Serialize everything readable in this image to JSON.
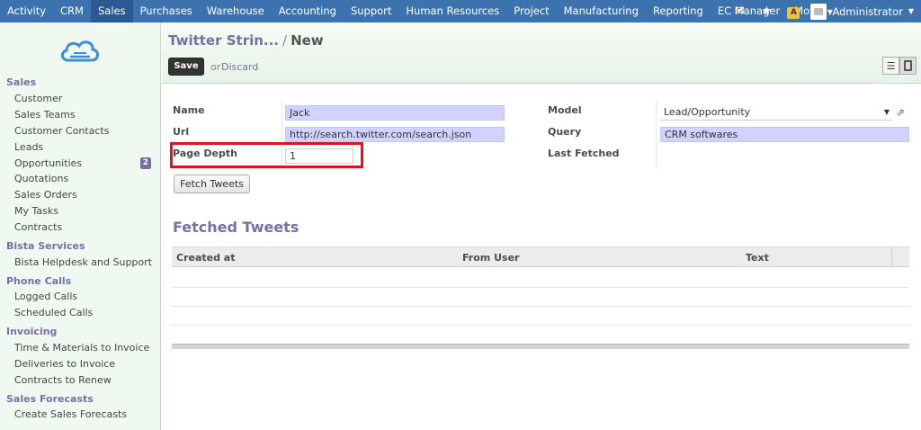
{
  "topnav": {
    "items": [
      "Activity",
      "CRM",
      "Sales",
      "Purchases",
      "Warehouse",
      "Accounting",
      "Support",
      "Human Resources",
      "Project",
      "Manufacturing",
      "Reporting",
      "EC Manager",
      "More"
    ],
    "active": "Sales",
    "user": "Administrator",
    "warning_badge": "A"
  },
  "sidebar": {
    "sections": [
      {
        "title": "Sales",
        "items": [
          "Customer",
          "Sales Teams",
          "Customer Contacts",
          "Leads",
          "Opportunities",
          "Quotations",
          "Sales Orders",
          "My Tasks",
          "Contracts"
        ]
      },
      {
        "title": "Bista Services",
        "items": [
          "Bista Helpdesk and Support"
        ]
      },
      {
        "title": "Phone Calls",
        "items": [
          "Logged Calls",
          "Scheduled Calls"
        ]
      },
      {
        "title": "Invoicing",
        "items": [
          "Time & Materials to Invoice",
          "Deliveries to Invoice",
          "Contracts to Renew"
        ]
      },
      {
        "title": "Sales Forecasts",
        "items": [
          "Create Sales Forecasts"
        ]
      }
    ],
    "opportunities_badge": "2"
  },
  "header": {
    "breadcrumb_parent": "Twitter Strin...",
    "breadcrumb_sep": "/",
    "breadcrumb_current": "New",
    "save_label": "Save",
    "or_label": "or",
    "discard_label": "Discard"
  },
  "form": {
    "name_label": "Name",
    "name_value": "Jack",
    "url_label": "Url",
    "url_value": "http://search.twitter.com/search.json",
    "page_depth_label": "Page Depth",
    "page_depth_value": "1",
    "model_label": "Model",
    "model_value": "Lead/Opportunity",
    "query_label": "Query",
    "query_value": "CRM softwares",
    "last_fetched_label": "Last Fetched",
    "fetch_button": "Fetch Tweets"
  },
  "tweets": {
    "title": "Fetched Tweets",
    "columns": [
      "Created at",
      "From User",
      "Text"
    ]
  },
  "colors": {
    "topbar": "#3c72ae",
    "accent": "#7a6fa5",
    "highlight_box": "#e0141c",
    "required_field": "#d2d2ff"
  }
}
